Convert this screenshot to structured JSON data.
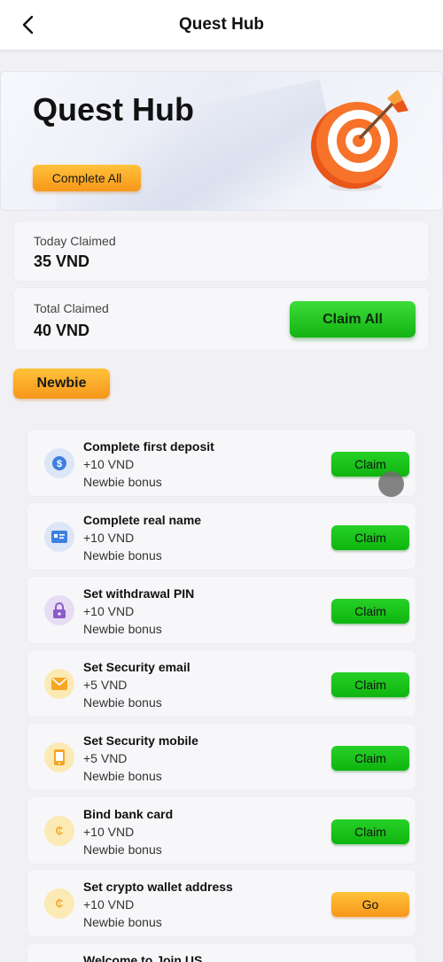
{
  "header": {
    "title": "Quest Hub",
    "back_icon": "chevron-left-icon"
  },
  "hero": {
    "title": "Quest Hub",
    "complete_all_label": "Complete All",
    "illustration": "target-dart-icon"
  },
  "stats": {
    "today": {
      "label": "Today Claimed",
      "value": "35 VND"
    },
    "total": {
      "label": "Total Claimed",
      "value": "40 VND"
    },
    "claim_all_label": "Claim All"
  },
  "category_tab": {
    "label": "Newbie"
  },
  "tasks": [
    {
      "title": "Complete first deposit",
      "reward": "+10 VND",
      "subtitle": "Newbie bonus",
      "button": "Claim",
      "icon": "dollar-coin-icon"
    },
    {
      "title": "Complete real name",
      "reward": "+10 VND",
      "subtitle": "Newbie bonus",
      "button": "Claim",
      "icon": "id-card-icon"
    },
    {
      "title": "Set withdrawal PIN",
      "reward": "+10 VND",
      "subtitle": "Newbie bonus",
      "button": "Claim",
      "icon": "lock-icon"
    },
    {
      "title": "Set Security email",
      "reward": "+5 VND",
      "subtitle": "Newbie bonus",
      "button": "Claim",
      "icon": "envelope-icon"
    },
    {
      "title": "Set Security mobile",
      "reward": "+5 VND",
      "subtitle": "Newbie bonus",
      "button": "Claim",
      "icon": "mobile-phone-icon"
    },
    {
      "title": "Bind bank card",
      "reward": "+10 VND",
      "subtitle": "Newbie bonus",
      "button": "Claim",
      "icon": "coin-icon"
    },
    {
      "title": "Set crypto wallet address",
      "reward": "+10 VND",
      "subtitle": "Newbie bonus",
      "button": "Go",
      "icon": "coin-icon"
    },
    {
      "title": "Welcome to Join US",
      "reward": "",
      "subtitle": "",
      "button": "",
      "icon": ""
    }
  ],
  "colors": {
    "claim_green": "#12b212",
    "go_orange": "#f7961a",
    "background": "#f1f1f5"
  }
}
